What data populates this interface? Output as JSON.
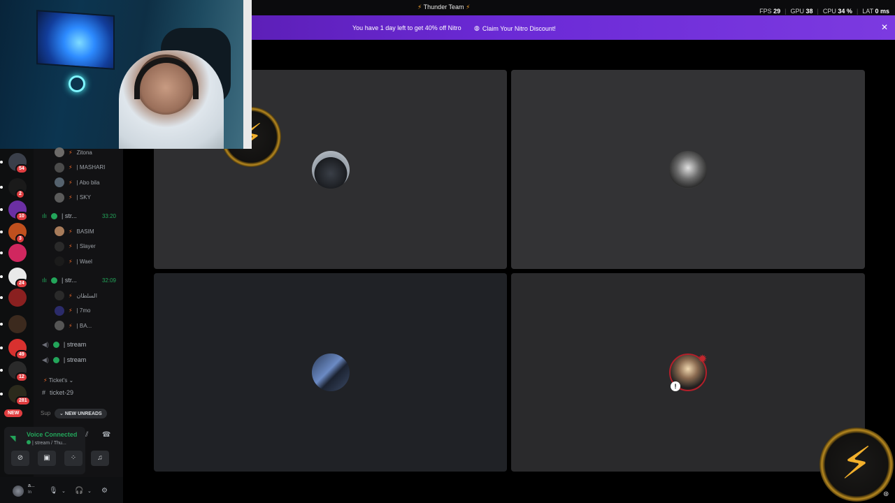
{
  "titlebar": {
    "app_title": "Thunder Team",
    "fps_label": "FPS",
    "fps_value": "29",
    "gpu_label": "GPU",
    "gpu_value": "38",
    "cpu_label": "CPU",
    "cpu_value": "34 %",
    "lat_label": "LAT",
    "lat_value": "0 ms"
  },
  "banner": {
    "message": "You have 1 day left to get 40% off Nitro",
    "cta": "Claim Your Nitro Discount!"
  },
  "rail": {
    "servers": [
      {
        "badge": "54",
        "color": "#3a3f4a"
      },
      {
        "badge": "2",
        "color": "#1a1a1a"
      },
      {
        "badge": "10",
        "color": "#6b2fa3"
      },
      {
        "badge": "3",
        "color": "#c0501e"
      },
      {
        "badge": "",
        "color": "#d0275f"
      },
      {
        "badge": "24",
        "color": "#e9e9e9"
      },
      {
        "badge": "",
        "color": "#8a2020"
      },
      {
        "badge": "",
        "color": "#3c2a1e"
      },
      {
        "badge": "49",
        "color": "#d8312f"
      },
      {
        "badge": "12",
        "color": "#2a2a2a"
      },
      {
        "badge": "281",
        "color": "#2b2a1c"
      }
    ],
    "new_label": "NEW"
  },
  "channels": {
    "voice_users_top": [
      {
        "name": "Zitona",
        "color": "#6d6b69"
      },
      {
        "name": "| MASHARI",
        "color": "#4b4b4b"
      },
      {
        "name": "| Abo bila",
        "color": "#55626e"
      },
      {
        "name": "| SKY",
        "color": "#5b5b5b"
      }
    ],
    "stream1": {
      "name": "| str...",
      "time": "33:20"
    },
    "stream1_users": [
      {
        "name": "BASIM",
        "color": "#a77b5a"
      },
      {
        "name": "| Slayer",
        "color": "#2a2a2a"
      },
      {
        "name": "| Wael",
        "color": "#1b1b1b"
      }
    ],
    "stream2": {
      "name": "| str...",
      "time": "32:09"
    },
    "stream2_users": [
      {
        "name": "السلطان",
        "color": "#2a2a2a"
      },
      {
        "name": "| 7mo",
        "color": "#2b2b6a"
      },
      {
        "name": "| BA...",
        "color": "#555"
      }
    ],
    "stream3": "| stream",
    "stream4": "| stream",
    "category": "Ticket's",
    "ticket": "ticket-29",
    "sup_label": "Sup",
    "new_unreads": "NEW UNREADS"
  },
  "voice_panel": {
    "title": "Voice Connected",
    "subtitle": "| stream / Thu..."
  },
  "user_panel": {
    "name": "a...",
    "status": "In"
  }
}
